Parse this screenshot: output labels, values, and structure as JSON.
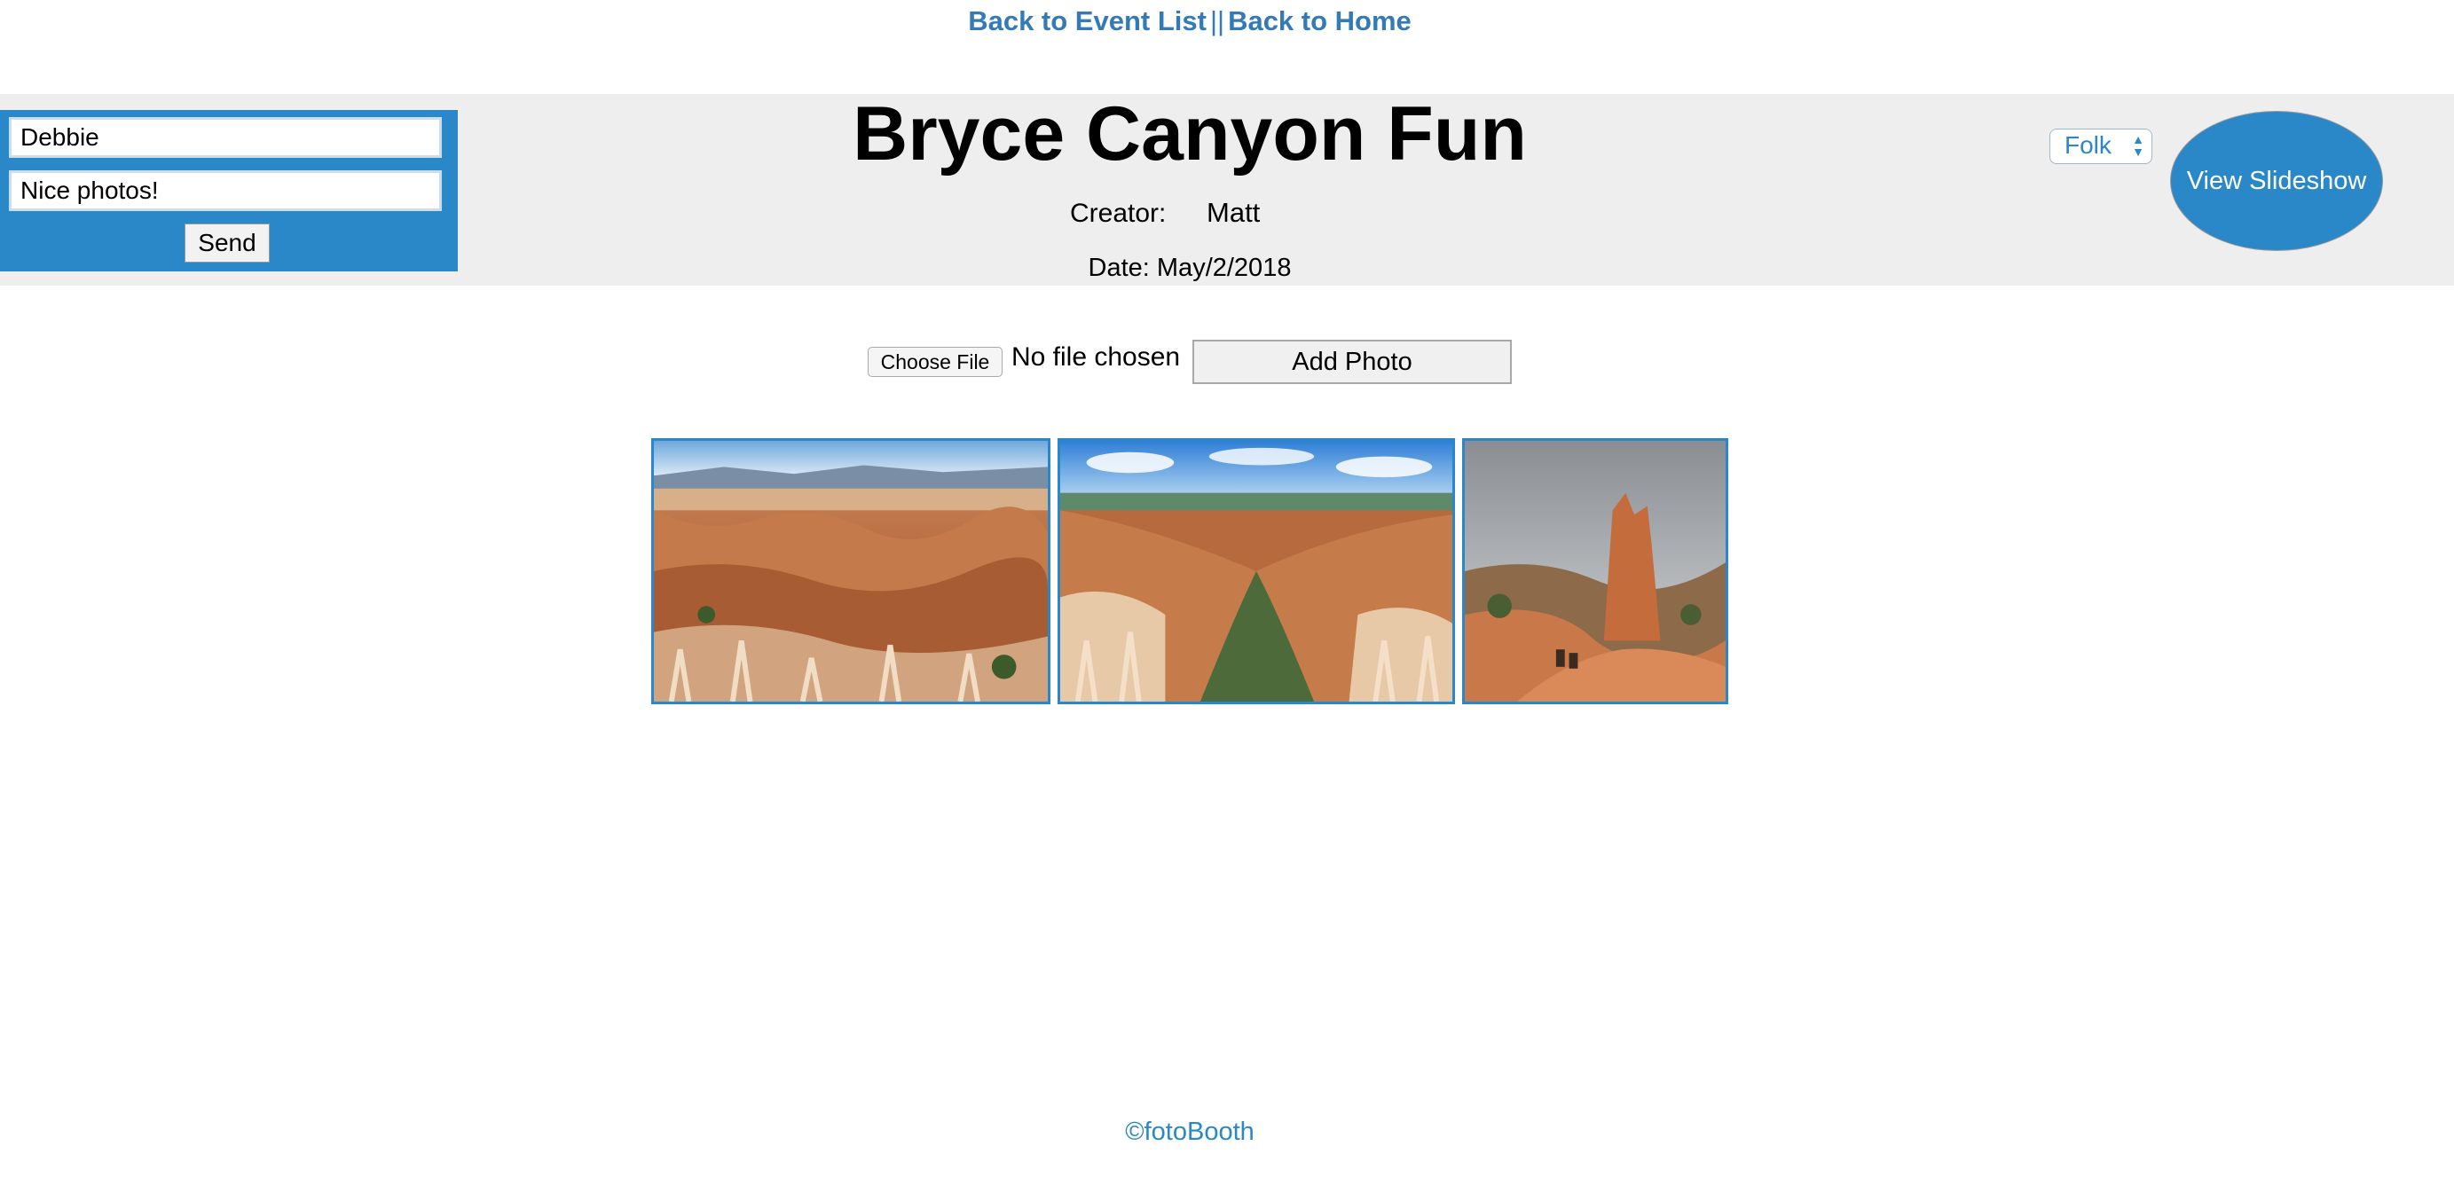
{
  "nav": {
    "event_list_label": "Back to Event List",
    "separator": "||",
    "home_label": "Back to Home"
  },
  "comment": {
    "name_value": "Debbie",
    "message_value": "Nice photos!",
    "send_label": "Send"
  },
  "event": {
    "title": "Bryce Canyon Fun",
    "creator_label": "Creator:",
    "creator_name": "Matt",
    "date_text": "Date: May/2/2018"
  },
  "music": {
    "selected": "Folk"
  },
  "slideshow": {
    "label": "View Slideshow"
  },
  "upload": {
    "choose_label": "Choose File",
    "status_text": "No file chosen",
    "add_label": "Add Photo"
  },
  "gallery": {
    "photos": [
      "canyon-photo",
      "canyon-photo",
      "canyon-photo"
    ]
  },
  "footer": {
    "text": "©fotoBooth"
  },
  "colors": {
    "accent": "#2a87c8",
    "link": "#337ab7",
    "header_band": "#eeeeee"
  }
}
